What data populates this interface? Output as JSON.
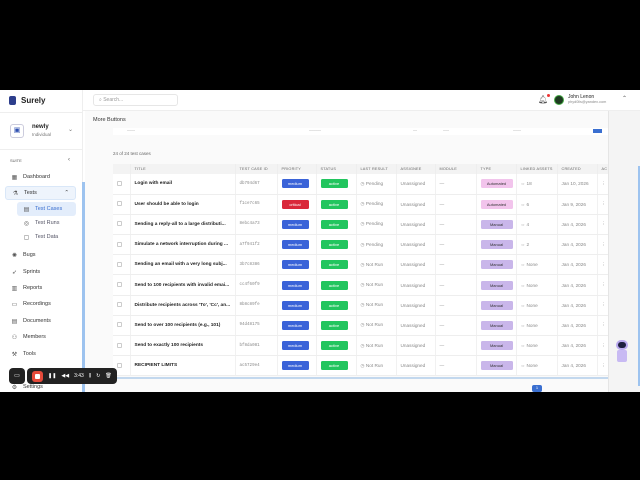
{
  "app": {
    "name": "Surely"
  },
  "workspace": {
    "name": "newly",
    "type": "Individual"
  },
  "sidebar": {
    "section": "SUITE",
    "items": [
      {
        "label": "Dashboard",
        "icon": "grid-icon"
      },
      {
        "label": "Tests",
        "icon": "flask-icon"
      },
      {
        "label": "Test Cases",
        "icon": "list-icon"
      },
      {
        "label": "Test Runs",
        "icon": "play-circle-icon"
      },
      {
        "label": "Test Data",
        "icon": "database-icon"
      },
      {
        "label": "Bugs",
        "icon": "bug-icon"
      },
      {
        "label": "Sprints",
        "icon": "rocket-icon"
      },
      {
        "label": "Reports",
        "icon": "bar-chart-icon"
      },
      {
        "label": "Recordings",
        "icon": "video-icon"
      },
      {
        "label": "Documents",
        "icon": "document-icon"
      },
      {
        "label": "Members",
        "icon": "users-icon"
      },
      {
        "label": "Tools",
        "icon": "wrench-icon"
      },
      {
        "label": "Settings",
        "icon": "gear-icon"
      }
    ]
  },
  "header": {
    "search_placeholder": "Search...",
    "user": {
      "name": "John Lenon",
      "email": "phyd0lls@yandex.com"
    }
  },
  "main": {
    "title": "More Buttons",
    "count": "24 of 24 test cases"
  },
  "table": {
    "headers": [
      "TITLE",
      "TEST CASE ID",
      "PRIORITY",
      "STATUS",
      "LAST RESULT",
      "ASSIGNEE",
      "MODULE",
      "TYPE",
      "LINKED ASSETS",
      "CREATED",
      "AC"
    ],
    "rows": [
      {
        "title": "Login with email",
        "id": "db794d67",
        "priority": "medium",
        "status": "active",
        "result": "Pending",
        "assignee": "Unassigned",
        "module": "—",
        "type": "Automated",
        "linked": "18",
        "created": "Jan 10, 2026"
      },
      {
        "title": "User should be able to login",
        "id": "f1ce7c65",
        "priority": "critical",
        "status": "active",
        "result": "Pending",
        "assignee": "Unassigned",
        "module": "—",
        "type": "Automated",
        "linked": "6",
        "created": "Jan 9, 2026"
      },
      {
        "title": "Sending a reply-all to a large distributi...",
        "id": "8ebc4a73",
        "priority": "medium",
        "status": "active",
        "result": "Pending",
        "assignee": "Unassigned",
        "module": "—",
        "type": "Manual",
        "linked": "4",
        "created": "Jan 4, 2026"
      },
      {
        "title": "Simulate a network interruption during ...",
        "id": "a7f941f2",
        "priority": "medium",
        "status": "active",
        "result": "Pending",
        "assignee": "Unassigned",
        "module": "—",
        "type": "Manual",
        "linked": "2",
        "created": "Jan 4, 2026"
      },
      {
        "title": "Sending an email with a very long subj...",
        "id": "3b7c8386",
        "priority": "medium",
        "status": "active",
        "result": "Not Run",
        "assignee": "Unassigned",
        "module": "—",
        "type": "Manual",
        "linked": "None",
        "created": "Jan 4, 2026"
      },
      {
        "title": "Send to 100 recipients with invalid emai...",
        "id": "cc4f60f9",
        "priority": "medium",
        "status": "active",
        "result": "Not Run",
        "assignee": "Unassigned",
        "module": "—",
        "type": "Manual",
        "linked": "None",
        "created": "Jan 4, 2026"
      },
      {
        "title": "Distribute recipients across 'To', 'Cc', an...",
        "id": "8b8c89fe",
        "priority": "medium",
        "status": "active",
        "result": "Not Run",
        "assignee": "Unassigned",
        "module": "—",
        "type": "Manual",
        "linked": "None",
        "created": "Jan 4, 2026"
      },
      {
        "title": "Send to over 100 recipients (e.g., 101)",
        "id": "94d48175",
        "priority": "medium",
        "status": "active",
        "result": "Not Run",
        "assignee": "Unassigned",
        "module": "—",
        "type": "Manual",
        "linked": "None",
        "created": "Jan 4, 2026"
      },
      {
        "title": "Send to exactly 100 recipients",
        "id": "bf8da081",
        "priority": "medium",
        "status": "active",
        "result": "Not Run",
        "assignee": "Unassigned",
        "module": "—",
        "type": "Manual",
        "linked": "None",
        "created": "Jan 4, 2026"
      },
      {
        "title": "RECIPIENT LIMITS",
        "id": "ac5729e4",
        "priority": "medium",
        "status": "active",
        "result": "Not Run",
        "assignee": "Unassigned",
        "module": "—",
        "type": "Manual",
        "linked": "None",
        "created": "Jan 4, 2026"
      }
    ]
  },
  "colors": {
    "medium": "#3a63d8",
    "critical": "#d9283a",
    "active": "#22c55e",
    "Automated": "#f2c4ec",
    "Manual": "#c9b6ea"
  },
  "recorder": {
    "time": "3:43"
  },
  "pagination": {
    "current": "1"
  }
}
